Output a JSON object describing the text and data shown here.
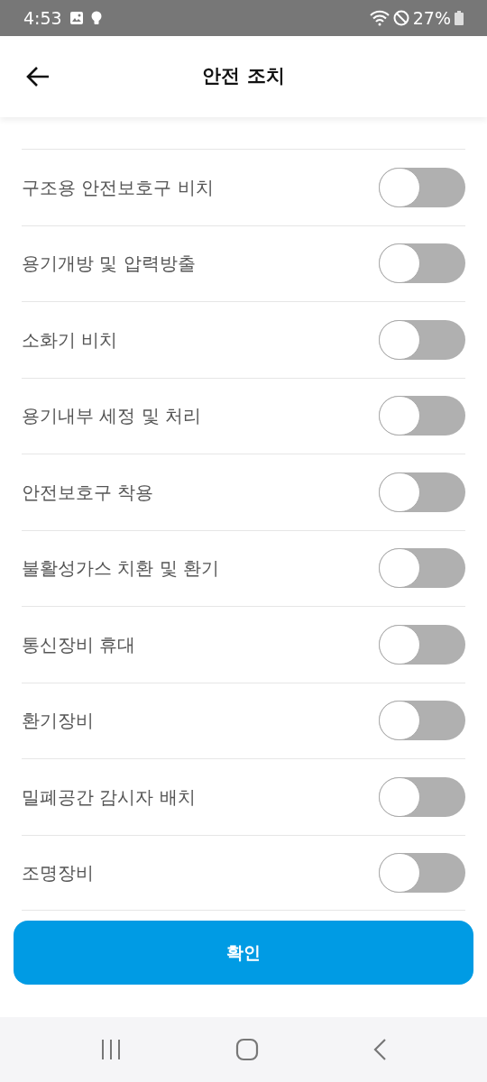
{
  "status_bar": {
    "time": "4:53",
    "battery": "27%"
  },
  "header": {
    "title": "안전 조치"
  },
  "items": [
    {
      "label": "구조용 안전보호구 비치",
      "on": false
    },
    {
      "label": "용기개방 및 압력방출",
      "on": false
    },
    {
      "label": "소화기 비치",
      "on": false
    },
    {
      "label": "용기내부 세정 및 처리",
      "on": false
    },
    {
      "label": "안전보호구 착용",
      "on": false
    },
    {
      "label": "불활성가스 치환 및 환기",
      "on": false
    },
    {
      "label": "통신장비 휴대",
      "on": false
    },
    {
      "label": "환기장비",
      "on": false
    },
    {
      "label": "밀폐공간 감시자 배치",
      "on": false
    },
    {
      "label": "조명장비",
      "on": false
    }
  ],
  "confirm_button": "확인"
}
